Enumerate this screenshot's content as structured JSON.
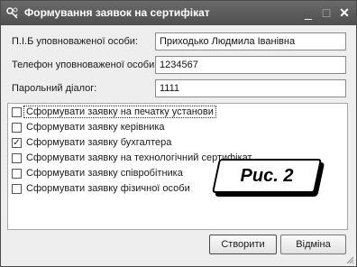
{
  "window": {
    "title": "Формування заявок на сертифікат",
    "icon": "keys-icon",
    "controls": {
      "minimize": "_",
      "maximize": "□",
      "close": "✕"
    }
  },
  "form": {
    "full_name": {
      "label": "П.І.Б уповноваженої особи:",
      "value": "Приходько Людмила Іванівна"
    },
    "phone": {
      "label": "Телефон уповноваженої особи:",
      "value": "1234567"
    },
    "passphrase": {
      "label": "Парольний діалог:",
      "value": "1111"
    }
  },
  "options": [
    {
      "label": "Сформувати заявку на печатку установи",
      "checked": false,
      "focused": true
    },
    {
      "label": "Сформувати заявку керівника",
      "checked": false,
      "focused": false
    },
    {
      "label": "Сформувати заявку бухгалтера",
      "checked": true,
      "focused": false
    },
    {
      "label": "Сформувати заявку на технологічний сертифікат",
      "checked": false,
      "focused": false
    },
    {
      "label": "Сформувати заявку співробітника",
      "checked": false,
      "focused": false
    },
    {
      "label": "Сформувати заявку фізичної особи",
      "checked": false,
      "focused": false
    }
  ],
  "figure_label": "Рис. 2",
  "buttons": {
    "create": "Створити",
    "cancel": "Відміна"
  }
}
